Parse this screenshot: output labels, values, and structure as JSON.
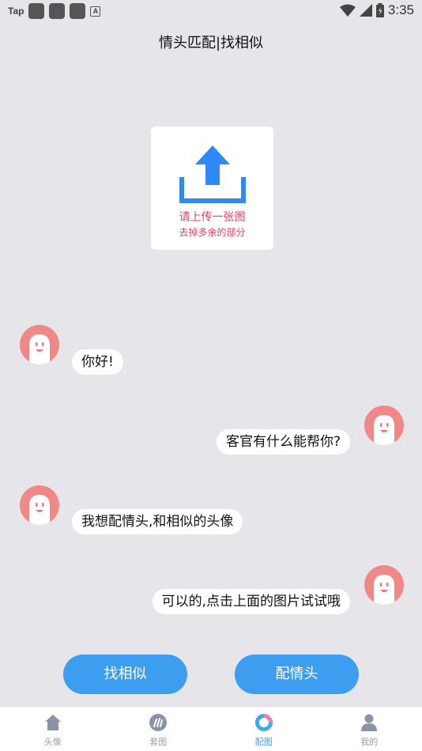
{
  "status_bar": {
    "app_label": "Tap",
    "badge_letter": "A",
    "time": "3:35"
  },
  "header": {
    "title": "情头匹配|找相似"
  },
  "upload": {
    "line1": "请上传一张图",
    "line2": "去掉多余的部分",
    "icon": "upload-icon",
    "accent_color": "#e83d5e",
    "icon_color": "#2d8af2"
  },
  "chat": {
    "messages": [
      {
        "side": "left",
        "text": "你好!"
      },
      {
        "side": "right",
        "text": "客官有什么能帮你?"
      },
      {
        "side": "left",
        "text": "我想配情头,和相似的头像"
      },
      {
        "side": "right",
        "text": "可以的,点击上面的图片试试哦"
      }
    ],
    "avatar_color": "#f08888"
  },
  "actions": {
    "find_similar": "找相似",
    "match_couple": "配情头",
    "button_color": "#3d9ef0"
  },
  "nav": {
    "items": [
      {
        "label": "头像",
        "icon": "home-icon",
        "active": false
      },
      {
        "label": "套图",
        "icon": "brush-icon",
        "active": false
      },
      {
        "label": "配图",
        "icon": "ring-icon",
        "active": true
      },
      {
        "label": "我的",
        "icon": "user-icon",
        "active": false
      }
    ],
    "active_color": "#3d9ef0",
    "inactive_color": "#9aa0b0"
  }
}
